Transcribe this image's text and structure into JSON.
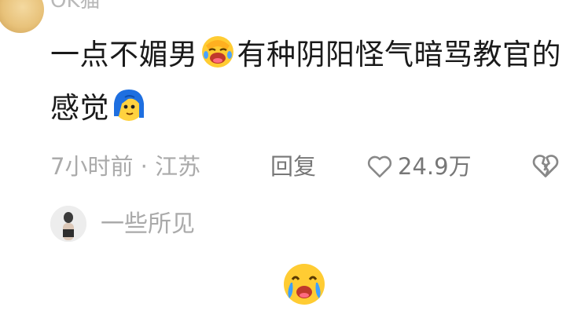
{
  "comment": {
    "username": "OK猫",
    "text_part1": "一点不媚男",
    "emoji1": "facepalm-laugh-emoji",
    "text_part2": "有种阴阳怪气暗骂教官的感觉",
    "emoji2": "blue-hair-emoji",
    "time_location": "7小时前 · 江苏",
    "reply_label": "回复",
    "like_count": "24.9万"
  },
  "reply_preview": {
    "name": "一些所见"
  },
  "icons": {
    "like": "heart-outline-icon",
    "dislike": "broken-heart-icon",
    "bottom": "crying-laughing-emoji"
  }
}
